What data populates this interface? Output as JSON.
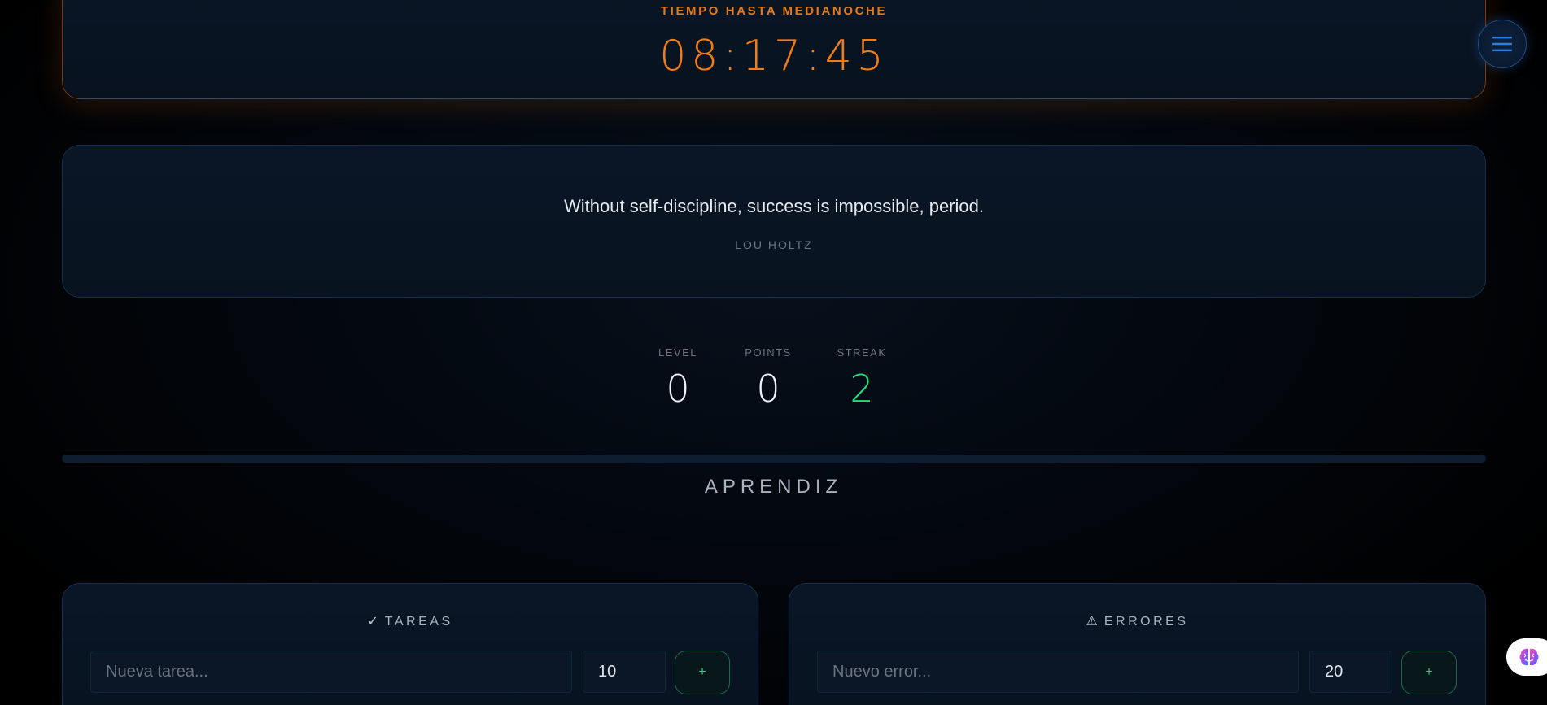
{
  "countdown": {
    "label": "TIEMPO HASTA MEDIANOCHE",
    "time": "08:17:45"
  },
  "menu": {
    "icon": "hamburger-menu-icon"
  },
  "quote": {
    "text": "Without self-discipline, success is impossible, period.",
    "author": "LOU HOLTZ"
  },
  "stats": {
    "level": {
      "label": "LEVEL",
      "value": "0"
    },
    "points": {
      "label": "POINTS",
      "value": "0"
    },
    "streak": {
      "label": "STREAK",
      "value": "2"
    }
  },
  "progress": {
    "percent": 0
  },
  "level_title": "APRENDIZ",
  "tasks": {
    "icon": "✓",
    "title": "TAREAS",
    "placeholder": "Nueva tarea...",
    "points": "10",
    "add_label": "+"
  },
  "errors": {
    "icon": "⚠",
    "title": "ERRORES",
    "placeholder": "Nuevo error...",
    "points": "20",
    "add_label": "+"
  },
  "widget": {
    "icon": "brain-icon"
  },
  "colors": {
    "accent_orange": "#ee7d1a",
    "accent_green": "#29d97a",
    "accent_blue": "#2f7fd6",
    "background": "#000000"
  }
}
